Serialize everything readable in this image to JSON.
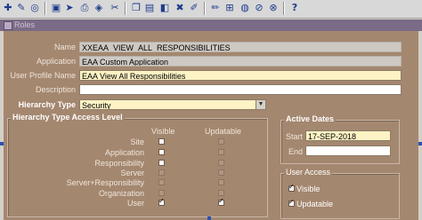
{
  "toolbar": {
    "icons": [
      "open-icon",
      "new-icon",
      "navigator-icon",
      "save-icon",
      "next-step-icon",
      "print-icon",
      "close-form-icon",
      "cut-icon",
      "copy-icon",
      "paste-icon",
      "clear-record-icon",
      "delete-icon",
      "edit-icon",
      "zoom-icon",
      "translate-icon",
      "attachments-icon",
      "folder-tools-icon",
      "help-icon"
    ],
    "help_glyph": "?"
  },
  "window": {
    "title": "Roles"
  },
  "form": {
    "name_label": "Name",
    "name_value": "XXEAA_VIEW_ALL_RESPONSIBILITIES",
    "application_label": "Application",
    "application_value": "EAA Custom Application",
    "user_profile_label": "User Profile Name",
    "user_profile_value": "EAA View All Responsibilities",
    "description_label": "Description",
    "description_value": "",
    "hierarchy_type_label": "Hierarchy Type",
    "hierarchy_type_value": "Security"
  },
  "access_level": {
    "title": "Hierarchy Type Access Level",
    "visible_header": "Visible",
    "updatable_header": "Updatable",
    "rows": [
      {
        "label": "Site",
        "visible": false,
        "updatable": false
      },
      {
        "label": "Application",
        "visible": false,
        "updatable": false
      },
      {
        "label": "Responsibility",
        "visible": false,
        "updatable": false
      },
      {
        "label": "Server",
        "visible": false,
        "updatable": false
      },
      {
        "label": "Server+Responsibility",
        "visible": false,
        "updatable": false
      },
      {
        "label": "Organization",
        "visible": false,
        "updatable": false
      },
      {
        "label": "User",
        "visible": true,
        "updatable": true
      }
    ]
  },
  "active_dates": {
    "title": "Active Dates",
    "start_label": "Start",
    "start_value": "17-SEP-2018",
    "end_label": "End",
    "end_value": ""
  },
  "user_access": {
    "title": "User Access",
    "visible_label": "Visible",
    "visible_checked": true,
    "updatable_label": "Updatable",
    "updatable_checked": true
  }
}
